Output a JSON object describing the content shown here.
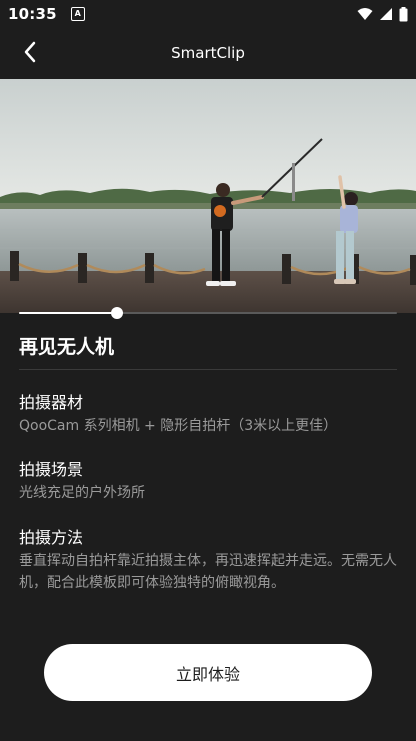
{
  "status_bar": {
    "time": "10:35",
    "app_icon_letter": "A",
    "icons": [
      "wifi-icon",
      "signal-icon",
      "battery-icon"
    ]
  },
  "header": {
    "title": "SmartClip",
    "back_icon": "chevron-left-icon"
  },
  "video": {
    "progress": 0.26
  },
  "template": {
    "title": "再见无人机"
  },
  "sections": [
    {
      "heading": "拍摄器材",
      "body": "QooCam 系列相机 + 隐形自拍杆（3米以上更佳）"
    },
    {
      "heading": "拍摄场景",
      "body": "光线充足的户外场所"
    },
    {
      "heading": "拍摄方法",
      "body": "垂直挥动自拍杆靠近拍摄主体，再迅速挥起并走远。无需无人机，配合此模板即可体验独特的俯瞰视角。"
    }
  ],
  "cta": {
    "label": "立即体验"
  },
  "colors": {
    "background": "#1d1d1d",
    "text_primary": "#ffffff",
    "text_secondary": "#9a9a9a",
    "button": "#ffffff"
  }
}
